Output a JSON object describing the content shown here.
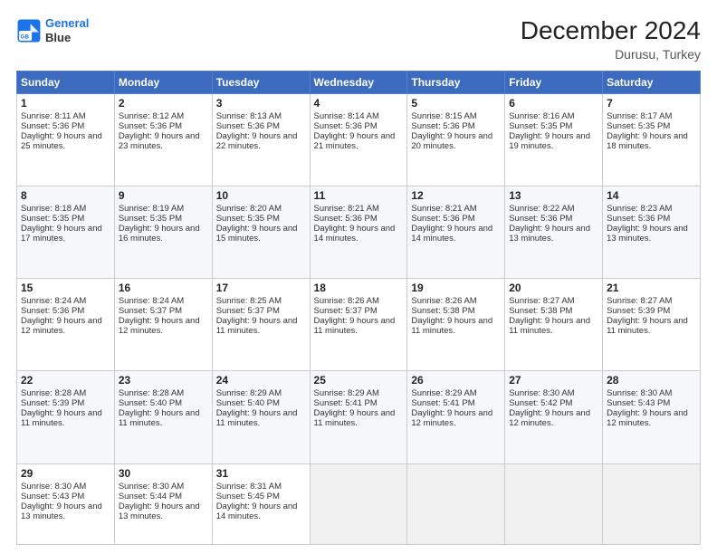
{
  "logo": {
    "line1": "General",
    "line2": "Blue"
  },
  "title": "December 2024",
  "subtitle": "Durusu, Turkey",
  "weekdays": [
    "Sunday",
    "Monday",
    "Tuesday",
    "Wednesday",
    "Thursday",
    "Friday",
    "Saturday"
  ],
  "weeks": [
    [
      {
        "day": 1,
        "sunrise": "8:11 AM",
        "sunset": "5:36 PM",
        "daylight": "9 hours and 25 minutes."
      },
      {
        "day": 2,
        "sunrise": "8:12 AM",
        "sunset": "5:36 PM",
        "daylight": "9 hours and 23 minutes."
      },
      {
        "day": 3,
        "sunrise": "8:13 AM",
        "sunset": "5:36 PM",
        "daylight": "9 hours and 22 minutes."
      },
      {
        "day": 4,
        "sunrise": "8:14 AM",
        "sunset": "5:36 PM",
        "daylight": "9 hours and 21 minutes."
      },
      {
        "day": 5,
        "sunrise": "8:15 AM",
        "sunset": "5:36 PM",
        "daylight": "9 hours and 20 minutes."
      },
      {
        "day": 6,
        "sunrise": "8:16 AM",
        "sunset": "5:35 PM",
        "daylight": "9 hours and 19 minutes."
      },
      {
        "day": 7,
        "sunrise": "8:17 AM",
        "sunset": "5:35 PM",
        "daylight": "9 hours and 18 minutes."
      }
    ],
    [
      {
        "day": 8,
        "sunrise": "8:18 AM",
        "sunset": "5:35 PM",
        "daylight": "9 hours and 17 minutes."
      },
      {
        "day": 9,
        "sunrise": "8:19 AM",
        "sunset": "5:35 PM",
        "daylight": "9 hours and 16 minutes."
      },
      {
        "day": 10,
        "sunrise": "8:20 AM",
        "sunset": "5:35 PM",
        "daylight": "9 hours and 15 minutes."
      },
      {
        "day": 11,
        "sunrise": "8:21 AM",
        "sunset": "5:36 PM",
        "daylight": "9 hours and 14 minutes."
      },
      {
        "day": 12,
        "sunrise": "8:21 AM",
        "sunset": "5:36 PM",
        "daylight": "9 hours and 14 minutes."
      },
      {
        "day": 13,
        "sunrise": "8:22 AM",
        "sunset": "5:36 PM",
        "daylight": "9 hours and 13 minutes."
      },
      {
        "day": 14,
        "sunrise": "8:23 AM",
        "sunset": "5:36 PM",
        "daylight": "9 hours and 13 minutes."
      }
    ],
    [
      {
        "day": 15,
        "sunrise": "8:24 AM",
        "sunset": "5:36 PM",
        "daylight": "9 hours and 12 minutes."
      },
      {
        "day": 16,
        "sunrise": "8:24 AM",
        "sunset": "5:37 PM",
        "daylight": "9 hours and 12 minutes."
      },
      {
        "day": 17,
        "sunrise": "8:25 AM",
        "sunset": "5:37 PM",
        "daylight": "9 hours and 11 minutes."
      },
      {
        "day": 18,
        "sunrise": "8:26 AM",
        "sunset": "5:37 PM",
        "daylight": "9 hours and 11 minutes."
      },
      {
        "day": 19,
        "sunrise": "8:26 AM",
        "sunset": "5:38 PM",
        "daylight": "9 hours and 11 minutes."
      },
      {
        "day": 20,
        "sunrise": "8:27 AM",
        "sunset": "5:38 PM",
        "daylight": "9 hours and 11 minutes."
      },
      {
        "day": 21,
        "sunrise": "8:27 AM",
        "sunset": "5:39 PM",
        "daylight": "9 hours and 11 minutes."
      }
    ],
    [
      {
        "day": 22,
        "sunrise": "8:28 AM",
        "sunset": "5:39 PM",
        "daylight": "9 hours and 11 minutes."
      },
      {
        "day": 23,
        "sunrise": "8:28 AM",
        "sunset": "5:40 PM",
        "daylight": "9 hours and 11 minutes."
      },
      {
        "day": 24,
        "sunrise": "8:29 AM",
        "sunset": "5:40 PM",
        "daylight": "9 hours and 11 minutes."
      },
      {
        "day": 25,
        "sunrise": "8:29 AM",
        "sunset": "5:41 PM",
        "daylight": "9 hours and 11 minutes."
      },
      {
        "day": 26,
        "sunrise": "8:29 AM",
        "sunset": "5:41 PM",
        "daylight": "9 hours and 12 minutes."
      },
      {
        "day": 27,
        "sunrise": "8:30 AM",
        "sunset": "5:42 PM",
        "daylight": "9 hours and 12 minutes."
      },
      {
        "day": 28,
        "sunrise": "8:30 AM",
        "sunset": "5:43 PM",
        "daylight": "9 hours and 12 minutes."
      }
    ],
    [
      {
        "day": 29,
        "sunrise": "8:30 AM",
        "sunset": "5:43 PM",
        "daylight": "9 hours and 13 minutes."
      },
      {
        "day": 30,
        "sunrise": "8:30 AM",
        "sunset": "5:44 PM",
        "daylight": "9 hours and 13 minutes."
      },
      {
        "day": 31,
        "sunrise": "8:31 AM",
        "sunset": "5:45 PM",
        "daylight": "9 hours and 14 minutes."
      },
      null,
      null,
      null,
      null
    ]
  ]
}
